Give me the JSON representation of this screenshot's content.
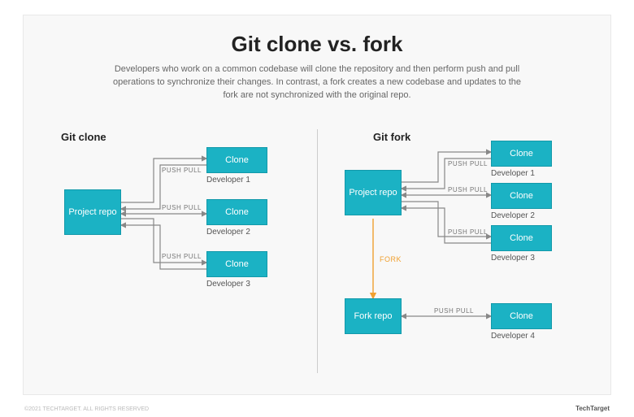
{
  "header": {
    "title": "Git clone vs. fork",
    "subtitle": "Developers who work on a common codebase will clone the repository and then perform push and pull operations to synchronize their changes. In contrast, a fork creates a new codebase and updates to the fork are not synchronized with the original repo."
  },
  "left": {
    "label": "Git clone",
    "repo": "Project repo",
    "edge_label": "PUSH PULL",
    "clones": [
      {
        "box": "Clone",
        "caption": "Developer 1"
      },
      {
        "box": "Clone",
        "caption": "Developer 2"
      },
      {
        "box": "Clone",
        "caption": "Developer 3"
      }
    ]
  },
  "right": {
    "label": "Git fork",
    "repo": "Project repo",
    "fork_repo": "Fork repo",
    "edge_label": "PUSH PULL",
    "fork_edge_label": "FORK",
    "clones": [
      {
        "box": "Clone",
        "caption": "Developer 1"
      },
      {
        "box": "Clone",
        "caption": "Developer 2"
      },
      {
        "box": "Clone",
        "caption": "Developer 3"
      },
      {
        "box": "Clone",
        "caption": "Developer 4"
      }
    ]
  },
  "footer": {
    "brand": "TechTarget",
    "copyright": "©2021 TECHTARGET. ALL RIGHTS RESERVED"
  }
}
